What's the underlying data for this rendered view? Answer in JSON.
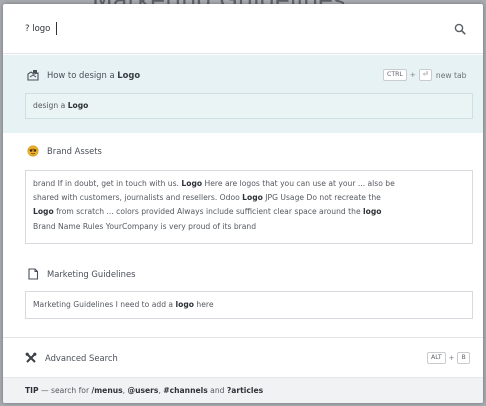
{
  "background": {
    "page_title": "Marketing Guidelines"
  },
  "search": {
    "value": "? logo",
    "placeholder": ""
  },
  "results": [
    {
      "prefix": "How to design a ",
      "highlight": "Logo",
      "icon": "article-icon",
      "snippet_parts": [
        "design a ",
        "Logo"
      ]
    },
    {
      "title": "Brand Assets",
      "icon": "emoji-icon",
      "snippet_line1_a": "brand If in doubt, get in touch with us. ",
      "snippet_line1_b": "Logo",
      "snippet_line1_c": " Here are logos that you can use at your ... also be",
      "snippet_line2_a": "shared with customers, journalists and resellers. Odoo ",
      "snippet_line2_b": "Logo",
      "snippet_line2_c": " JPG Usage Do not recreate the",
      "snippet_line3_a": "Logo",
      "snippet_line3_b": " from scratch ... colors provided Always include sufficient clear space around the ",
      "snippet_line3_c": "logo",
      "snippet_line4": "Brand Name Rules YourCompany is very proud of its brand"
    },
    {
      "title": "Marketing Guidelines",
      "icon": "document-icon",
      "snippet_a": "Marketing Guidelines I need to add a ",
      "snippet_b": "logo",
      "snippet_c": " here"
    }
  ],
  "shortcut_new_tab": {
    "key1": "CTRL",
    "plus": "+",
    "key2": "⏎",
    "label": "new tab"
  },
  "advanced": {
    "label": "Advanced Search",
    "key1": "ALT",
    "plus": "+",
    "key2": "B"
  },
  "tip": {
    "label": "TIP",
    "text_a": " — search for ",
    "menus": "/menus",
    "sep1": ", ",
    "users": "@users",
    "sep2": ", ",
    "channels": "#channels",
    "sep3": " and ",
    "articles": "?articles"
  },
  "colors": {
    "accent_bg": "#e6f2f3",
    "text": "#4a4f58"
  }
}
